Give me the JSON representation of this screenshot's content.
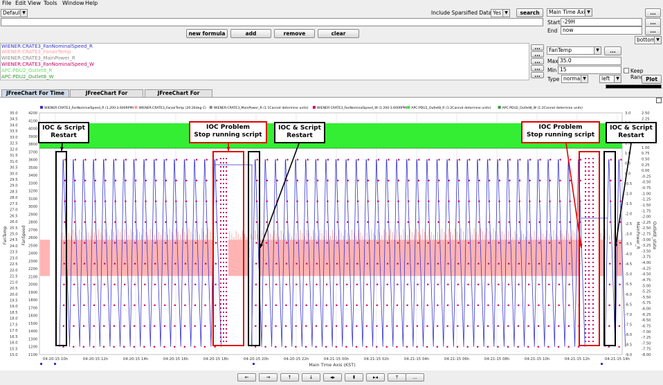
{
  "menu": [
    "File",
    "Edit",
    "View",
    "Tools",
    "Window",
    "Help"
  ],
  "toolbar": {
    "profile": "Default",
    "include_sparsified_label": "Include Sparsified Data",
    "include_sparsified_value": "Yes",
    "search_label": "search",
    "new_formula_label": "new formula",
    "add_label": "add",
    "remove_label": "remove",
    "clear_label": "clear"
  },
  "time_axis": {
    "selected": "Main Time Axis",
    "start_label": "Start",
    "start_value": "-29H",
    "end_label": "End",
    "end_value": "now",
    "more": "...",
    "legend_position": "bottom"
  },
  "pvs": [
    {
      "name": "WIENER:CRATE3_FanNominalSpeed_R",
      "color": "#3333cc"
    },
    {
      "name": "WIENER:CRATE3_FanairTemp",
      "color": "#ff9999"
    },
    {
      "name": "WIENER:CRATE3_MainPower_R",
      "color": "#888888"
    },
    {
      "name": "WIENER:CRATE3_FanNominalSpeed_W",
      "color": "#cc0066"
    },
    {
      "name": "APC:PDU2_Outlet8_R",
      "color": "#66dd66"
    },
    {
      "name": "APC:PDU2_Outlet8_W",
      "color": "#339933"
    }
  ],
  "axis_panel": {
    "selected": "FanTemp",
    "max_label": "Max",
    "max_value": "35.0",
    "min_label": "Min",
    "min_value": "15",
    "type_label": "Type",
    "type_value": "normal",
    "side_value": "left",
    "keep_ranges_label": "Keep Ranges",
    "plot_label": "Plot"
  },
  "tabs": [
    "JFreeChart For Time Plots",
    "JFreeChart For Correlations",
    "JFreeChart For Waveforms"
  ],
  "legend": [
    {
      "label": "WIENER:CRATE3_FanNominalSpeed_R (1.200:3.600RPM)",
      "color": "#3333cc"
    },
    {
      "label": "WIENER:CRATE3_FanairTemp (20:26deg C)",
      "color": "#ff9999"
    },
    {
      "label": "WIENER:CRATE3_MainPower_R (1:1Cannot determine units)",
      "color": "#888888"
    },
    {
      "label": "WIENER:CRATE3_FanNominalSpeed_W (1.200:3.600RPM)",
      "color": "#cc0066"
    },
    {
      "label": "APC:PDU2_Outlet8_R (1:2Cannot determine units)",
      "color": "#33ee33"
    },
    {
      "label": "APC:PDU2_Outlet8_W (1:2Cannot determine units)",
      "color": "#339933"
    }
  ],
  "chart_data": {
    "type": "line",
    "xlabel": "Main Time Axis (KST)",
    "x_ticks": [
      "04-20-15 10h",
      "04-20-15 12h",
      "04-20-15 14h",
      "04-20-15 16h",
      "04-20-15 18h",
      "04-20-15 20h",
      "04-20-15 22h",
      "04-21-15 00h",
      "04-21-15 02h",
      "04-21-15 04h",
      "04-21-15 06h",
      "04-21-15 08h",
      "04-21-15 10h",
      "04-21-15 12h",
      "04-21-15 14h"
    ],
    "axes": {
      "fantemp": {
        "label": "FanTemp",
        "range": [
          15.0,
          35.0
        ],
        "ticks": [
          "35.0",
          "34.5",
          "34.0",
          "33.5",
          "33.0",
          "32.5",
          "32.0",
          "31.5",
          "31.0",
          "30.5",
          "30.0",
          "29.5",
          "29.0",
          "28.5",
          "28.0",
          "27.5",
          "27.0",
          "26.5",
          "26.0",
          "25.5",
          "25.0",
          "24.5",
          "24.0",
          "23.5",
          "23.0",
          "22.5",
          "22.0",
          "21.5",
          "21.0",
          "20.5",
          "20.0",
          "19.5",
          "19.0",
          "18.5",
          "18.0",
          "17.5",
          "17.0",
          "16.5",
          "16.0",
          "15.5",
          "15.0"
        ]
      },
      "fanspeed": {
        "label": "FanSpeed",
        "range": [
          1100,
          4200
        ],
        "ticks": [
          "4200",
          "4100",
          "4000",
          "3900",
          "3800",
          "3700",
          "3600",
          "3500",
          "3400",
          "3300",
          "3200",
          "3100",
          "3000",
          "2900",
          "2800",
          "2700",
          "2600",
          "2500",
          "2400",
          "2300",
          "2200",
          "2100",
          "2000",
          "1900",
          "1800",
          "1700",
          "1600",
          "1500",
          "1400",
          "1300",
          "1200",
          "1100"
        ]
      },
      "mainpower": {
        "label": "MainPower_R",
        "ticks": [
          "3.0",
          "2.5",
          "2.0",
          "1.5",
          "1.0",
          "0.5",
          "0.0",
          "-0.5",
          "-1.0",
          "-1.5",
          "-2.0",
          "-2.5",
          "-3.0",
          "-3.5",
          "-4.0",
          "-4.5",
          "-5.0",
          "-5.5",
          "-6.0",
          "-6.5",
          "-7.0",
          "-7.5",
          "-8.0",
          "-8.5",
          "-9.0"
        ]
      },
      "outlet": {
        "label": "Outlet8_state",
        "ticks": [
          "2.50",
          "2.25",
          "2.00",
          "1.75",
          "1.50",
          "1.25",
          "1.00",
          "0.75",
          "0.50",
          "0.25",
          "0.00",
          "-0.25",
          "-0.50",
          "-0.75",
          "-1.00",
          "-1.25",
          "-1.50",
          "-1.75",
          "-2.00",
          "-2.25",
          "-2.50",
          "-2.75",
          "-3.00",
          "-3.25",
          "-3.50",
          "-3.75",
          "-4.00",
          "-4.25",
          "-4.50",
          "-4.75",
          "-5.00",
          "-5.25",
          "-5.50",
          "-5.75",
          "-6.00",
          "-6.25",
          "-6.50",
          "-6.75",
          "-7.00",
          "-7.25",
          "-7.50",
          "-7.75",
          "-8.00"
        ]
      }
    },
    "fanspeed_cycle": {
      "min": 1200,
      "max": 3600
    },
    "fantemp_band": {
      "min": 21.5,
      "max": 24.5
    },
    "outlet_value": 1.25
  },
  "annotations": [
    {
      "line1": "IOC & Script",
      "line2": "Restart"
    },
    {
      "line1": "IOC Problem",
      "line2": "Stop running script"
    },
    {
      "line1": "IOC & Script",
      "line2": "Restart"
    },
    {
      "line1": "IOC Problem",
      "line2": "Stop running script"
    },
    {
      "line1": "IOC & Script",
      "line2": "Restart"
    }
  ],
  "nav_buttons": [
    "←",
    "→",
    "↑",
    "↓",
    "◂▸",
    "⬍",
    "▸◂",
    "⤒",
    "..."
  ]
}
